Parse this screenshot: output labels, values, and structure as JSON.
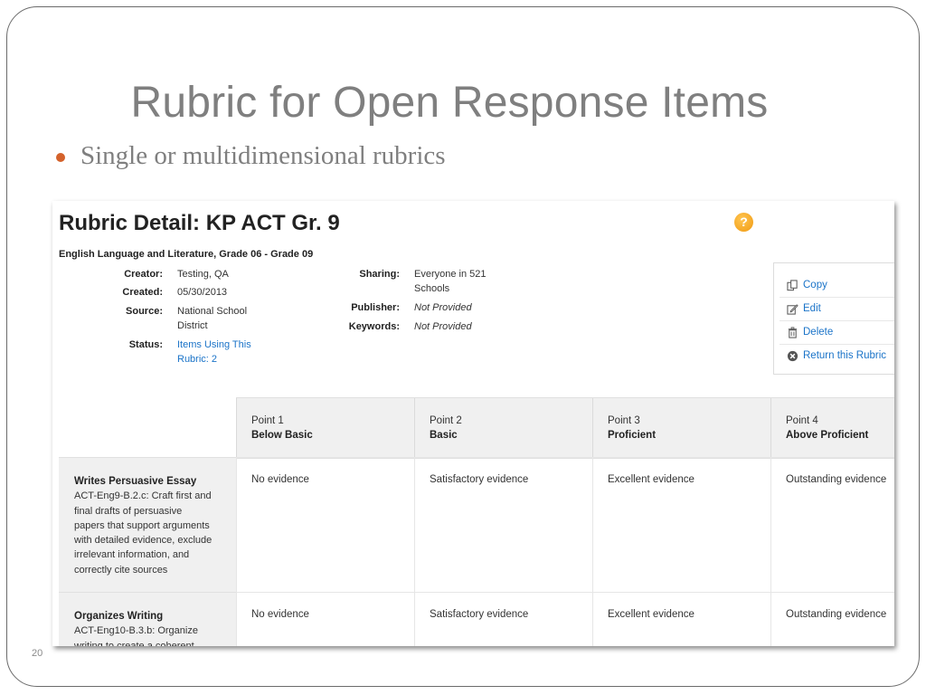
{
  "slide": {
    "title": "Rubric for Open Response Items",
    "bullet": "Single or multidimensional rubrics",
    "number": "20"
  },
  "rubric": {
    "title": "Rubric Detail: KP ACT Gr. 9",
    "help": "?",
    "subject": "English Language and Literature, Grade 06 - Grade 09",
    "meta_left": [
      {
        "label": "Creator:",
        "value": "Testing, QA"
      },
      {
        "label": "Created:",
        "value": "05/30/2013"
      },
      {
        "label": "Source:",
        "value": "National School District"
      },
      {
        "label": "Status:",
        "value": "Items Using This Rubric: 2"
      }
    ],
    "meta_right": [
      {
        "label": "Sharing:",
        "value": "Everyone in 521 Schools"
      },
      {
        "label": "Publisher:",
        "value": "Not Provided"
      },
      {
        "label": "Keywords:",
        "value": "Not Provided"
      }
    ],
    "actions": [
      {
        "label": "Copy",
        "icon": "copy-icon"
      },
      {
        "label": "Edit",
        "icon": "edit-icon"
      },
      {
        "label": "Delete",
        "icon": "trash-icon"
      },
      {
        "label": "Return this Rubric",
        "icon": "circle-x-icon"
      }
    ],
    "columns": [
      {
        "point": "Point 1",
        "level": "Below Basic"
      },
      {
        "point": "Point 2",
        "level": "Basic"
      },
      {
        "point": "Point 3",
        "level": "Proficient"
      },
      {
        "point": "Point 4",
        "level": "Above Proficient"
      }
    ],
    "rows": [
      {
        "name": "Writes Persuasive Essay",
        "standard_lines": [
          "ACT-Eng9-B.2.c: Craft first and",
          "final drafts of persuasive",
          "papers that support arguments",
          "with detailed evidence, exclude",
          "irrelevant information, and",
          "correctly cite sources"
        ],
        "cells": [
          "No evidence",
          "Satisfactory evidence",
          "Excellent evidence",
          "Outstanding evidence"
        ]
      },
      {
        "name": "Organizes Writing",
        "standard_lines": [
          "ACT-Eng10-B.3.b: Organize",
          "writing to create a coherent"
        ],
        "cells": [
          "No evidence",
          "Satisfactory evidence",
          "Excellent evidence",
          "Outstanding evidence"
        ]
      }
    ]
  },
  "colors": {
    "accent": "#d4622b",
    "link": "#1a73c8",
    "help": "#f5a31a"
  }
}
